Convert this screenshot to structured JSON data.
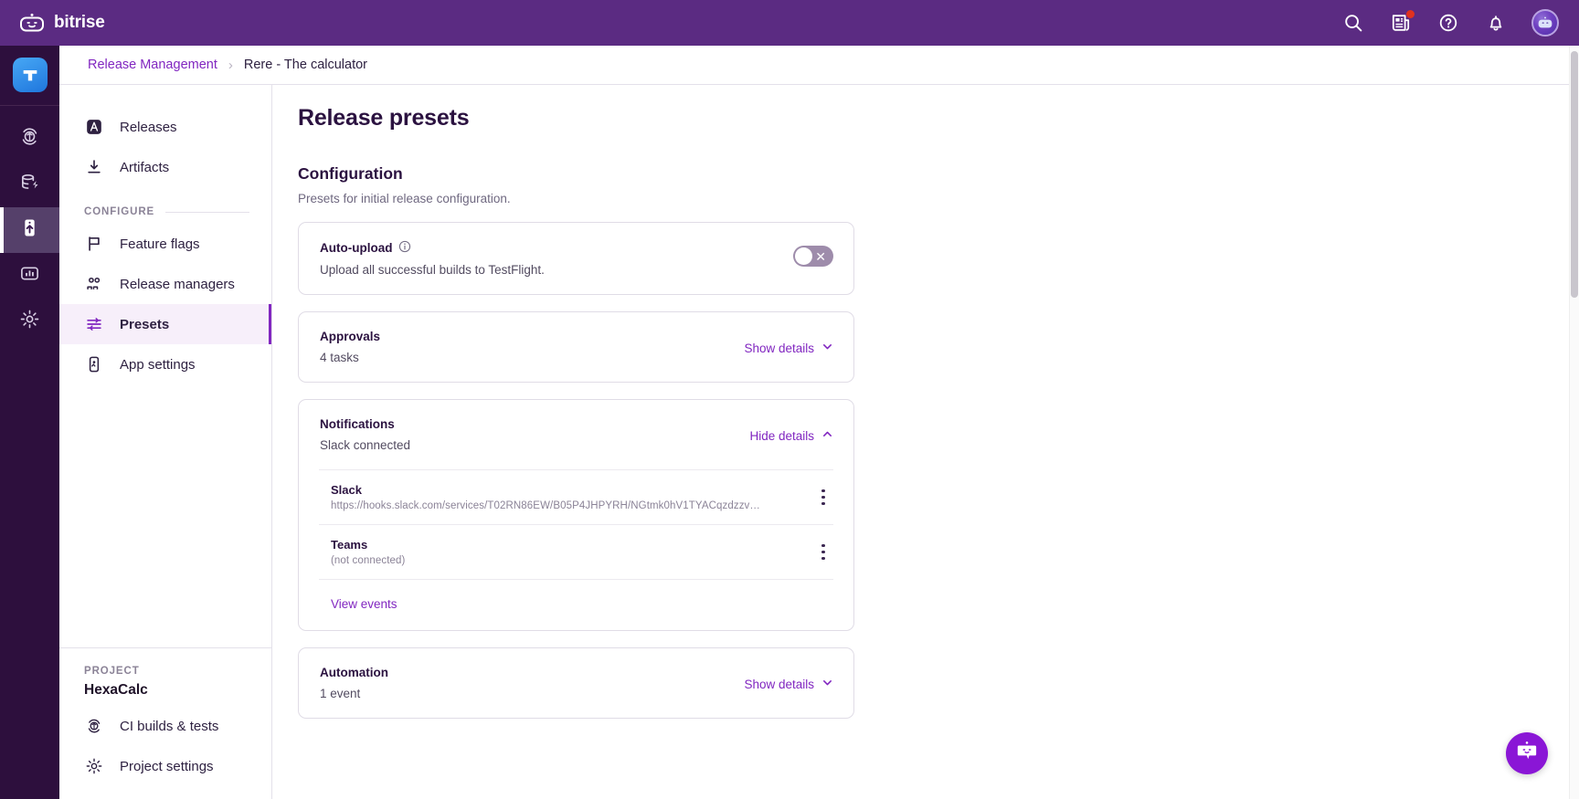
{
  "header": {
    "brand": "bitrise",
    "brand_logo_icon": "bitrise-robot-logo",
    "actions": [
      {
        "name": "search-icon",
        "label": "Search"
      },
      {
        "name": "whats-new-icon",
        "label": "What's new",
        "badge": true
      },
      {
        "name": "help-icon",
        "label": "Help"
      },
      {
        "name": "notifications-bell-icon",
        "label": "Notifications"
      }
    ],
    "avatar_label": "Account",
    "accent_color": "#5b2b82"
  },
  "rail": {
    "app_icon": "app-logo-icon",
    "items": [
      {
        "name": "ci-builds-icon",
        "label": "CI builds & tests",
        "active": false
      },
      {
        "name": "build-cache-icon",
        "label": "Build cache",
        "active": false
      },
      {
        "name": "release-management-icon",
        "label": "Release Management",
        "active": true
      },
      {
        "name": "insights-icon",
        "label": "Insights",
        "active": false
      },
      {
        "name": "settings-gear-icon",
        "label": "Settings",
        "active": false
      }
    ]
  },
  "breadcrumb": {
    "root": "Release Management",
    "separator": "›",
    "current": "Rere - The calculator"
  },
  "sidebar": {
    "items": [
      {
        "label": "Releases",
        "icon": "releases-icon",
        "selected": false
      },
      {
        "label": "Artifacts",
        "icon": "artifacts-download-icon",
        "selected": false
      }
    ],
    "section_label": "CONFIGURE",
    "configure_items": [
      {
        "label": "Feature flags",
        "icon": "flag-icon",
        "selected": false
      },
      {
        "label": "Release managers",
        "icon": "people-icon",
        "selected": false
      },
      {
        "label": "Presets",
        "icon": "sliders-icon",
        "selected": true
      },
      {
        "label": "App settings",
        "icon": "app-settings-icon",
        "selected": false
      }
    ],
    "project_kicker": "PROJECT",
    "project_name": "HexaCalc",
    "project_items": [
      {
        "label": "CI builds & tests",
        "icon": "ci-builds-icon"
      },
      {
        "label": "Project settings",
        "icon": "settings-gear-icon"
      }
    ]
  },
  "main": {
    "page_title": "Release presets",
    "section_title": "Configuration",
    "section_subtitle": "Presets for initial release configuration.",
    "auto_upload": {
      "title": "Auto-upload",
      "info_icon": "info-circle-icon",
      "description": "Upload all successful builds to TestFlight.",
      "toggle_state": "off",
      "toggle_mark": "✕"
    },
    "approvals": {
      "title": "Approvals",
      "subtitle": "4 tasks",
      "disclosure_label": "Show details",
      "disclosure_icon": "chevron-down-icon",
      "expanded": false
    },
    "notifications": {
      "title": "Notifications",
      "subtitle": "Slack connected",
      "disclosure_label": "Hide details",
      "disclosure_icon": "chevron-up-icon",
      "expanded": true,
      "channels": [
        {
          "name": "Slack",
          "meta": "https://hooks.slack.com/services/T02RN86EW/B05P4JHPYRH/NGtmk0hV1TYACqzdzzv…",
          "menu_icon": "kebab-menu-icon"
        },
        {
          "name": "Teams",
          "meta": "(not connected)",
          "menu_icon": "kebab-menu-icon"
        }
      ],
      "view_events_label": "View events"
    },
    "automation": {
      "title": "Automation",
      "subtitle": "1 event",
      "disclosure_label": "Show details",
      "disclosure_icon": "chevron-down-icon",
      "expanded": false
    }
  },
  "chat": {
    "icon": "chat-bot-icon",
    "label": "Open support chat",
    "color": "#8a16d6"
  },
  "colors": {
    "brand_purple": "#5b2b82",
    "link_purple": "#8126c0",
    "rail_dark": "#2d0f3d",
    "selected_bg": "#f7effa",
    "badge_red": "#e0321e"
  }
}
